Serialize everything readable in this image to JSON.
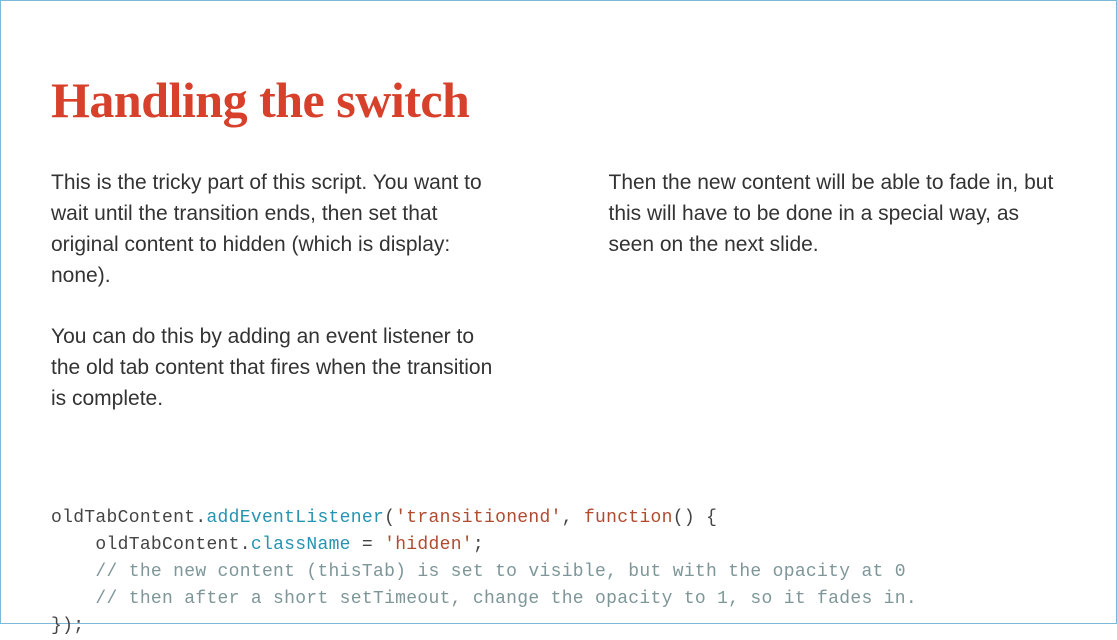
{
  "title": "Handling the switch",
  "left": {
    "p1": "This is the tricky part of this script. You want to wait until the transition ends, then set that original content to hidden (which is display: none).",
    "p2": "You can do this by adding an event listener to the old tab content that fires when the transition is complete."
  },
  "right": {
    "p1": "Then the new content will be able to fade in, but this will have to be done in a special way, as seen on the next slide."
  },
  "code": {
    "l1_ident": "oldTabContent",
    "l1_dot": ".",
    "l1_method": "addEventListener",
    "l1_open": "(",
    "l1_str": "'transitionend'",
    "l1_comma": ", ",
    "l1_kw": "function",
    "l1_tail": "() {",
    "l2_indent": "    ",
    "l2_ident": "oldTabContent",
    "l2_dot": ".",
    "l2_prop": "className",
    "l2_eq": " = ",
    "l2_str": "'hidden'",
    "l2_semi": ";",
    "l3_indent": "    ",
    "l3_comment": "// the new content (thisTab) is set to visible, but with the opacity at 0",
    "l4_indent": "    ",
    "l4_comment": "// then after a short setTimeout, change the opacity to 1, so it fades in.",
    "l5": "});"
  }
}
